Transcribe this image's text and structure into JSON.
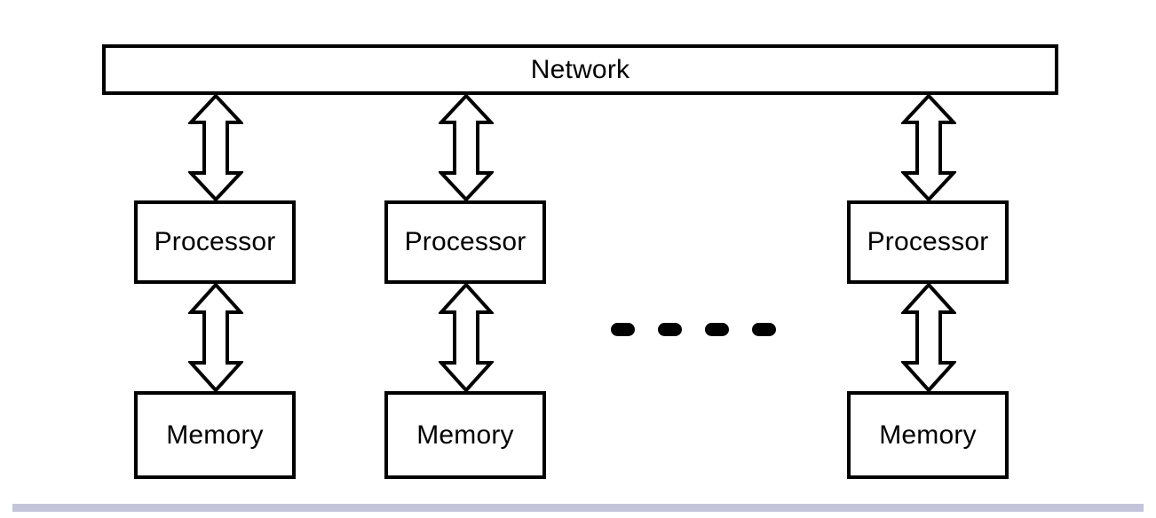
{
  "diagram": {
    "title_bar": {
      "label": "Network"
    },
    "columns": [
      {
        "id": "node-1",
        "processor_label": "Processor",
        "memory_label": "Memory",
        "network_link_icon": "double-headed-vertical-arrow-icon",
        "memory_link_icon": "double-headed-vertical-arrow-icon"
      },
      {
        "id": "node-2",
        "processor_label": "Processor",
        "memory_label": "Memory",
        "network_link_icon": "double-headed-vertical-arrow-icon",
        "memory_link_icon": "double-headed-vertical-arrow-icon"
      },
      {
        "id": "node-n",
        "processor_label": "Processor",
        "memory_label": "Memory",
        "network_link_icon": "double-headed-vertical-arrow-icon",
        "memory_link_icon": "double-headed-vertical-arrow-icon"
      }
    ],
    "continuation": {
      "icon": "horizontal-ellipsis-icon",
      "dash_count": 4
    },
    "colors": {
      "stroke": "#000000",
      "fill": "#ffffff",
      "background": "#ffffff",
      "bottom_strip": "#c4c5db"
    }
  }
}
